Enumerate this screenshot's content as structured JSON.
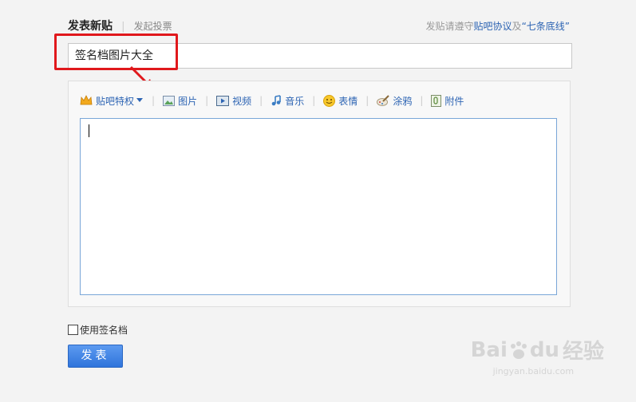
{
  "tabs": {
    "active": "发表新贴",
    "inactive": "发起投票"
  },
  "rules": {
    "prefix": "发贴请遵守",
    "link1": "贴吧协议",
    "middle": "及",
    "link2": "“七条底线”"
  },
  "title_input": {
    "value": "签名档图片大全"
  },
  "toolbar": {
    "privilege": "贴吧特权",
    "image": "图片",
    "video": "视频",
    "music": "音乐",
    "emoticon": "表情",
    "doodle": "涂鸦",
    "attachment": "附件"
  },
  "signature": {
    "label": "使用签名档"
  },
  "submit": {
    "label": "发表"
  },
  "watermark": {
    "brand_left": "Bai",
    "brand_right": "du",
    "brand_cn": "经验",
    "url": "jingyan.baidu.com"
  },
  "colors": {
    "link": "#2d64b3",
    "highlight": "#e0181c",
    "button": "#2f74db"
  },
  "icons": [
    "crown-icon",
    "image-icon",
    "video-icon",
    "music-note-icon",
    "smiley-icon",
    "paint-brush-icon",
    "attachment-icon",
    "dropdown-arrow-icon"
  ]
}
